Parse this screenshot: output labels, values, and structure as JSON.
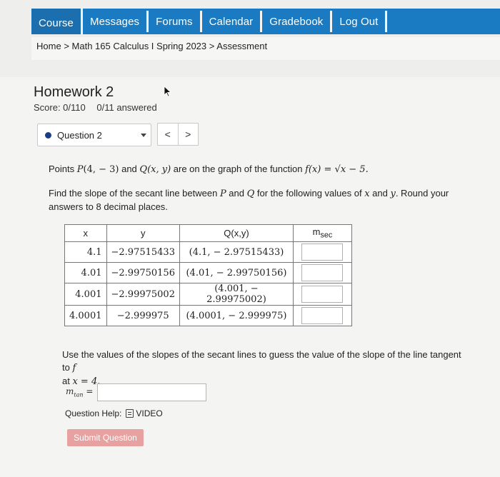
{
  "nav": {
    "tabs": [
      "Course",
      "Messages",
      "Forums",
      "Calendar",
      "Gradebook",
      "Log Out"
    ]
  },
  "breadcrumb": {
    "home": "Home",
    "course": "Math 165 Calculus I Spring 2023",
    "current": "Assessment",
    "sep": ">"
  },
  "assignment": {
    "title": "Homework 2",
    "score": "Score: 0/110",
    "answered": "0/11 answered"
  },
  "question_nav": {
    "selected": "Question 2",
    "prev": "<",
    "next": ">"
  },
  "problem": {
    "intro_a": "Points ",
    "P": "P",
    "P_coords": "(4, − 3)",
    "and": " and ",
    "Q": "Q",
    "Q_coords": "(x, y)",
    "intro_b": " are on the graph of the function ",
    "func": "f(x) = √x − 5.",
    "instr_a": "Find the slope of the secant line between ",
    "instr_P": "P",
    "instr_and": " and ",
    "instr_Q": "Q",
    "instr_b": " for the following values of ",
    "instr_x": "x",
    "instr_c": " and ",
    "instr_y": "y",
    "instr_d": ". Round your answers to 8 decimal places."
  },
  "table": {
    "headers": [
      "x",
      "y",
      "Q(x,y)",
      "m"
    ],
    "header_sub": "sec",
    "rows": [
      {
        "x": "4.1",
        "y": "−2.97515433",
        "q": "(4.1, − 2.97515433)",
        "m": ""
      },
      {
        "x": "4.01",
        "y": "−2.99750156",
        "q": "(4.01, − 2.99750156)",
        "m": ""
      },
      {
        "x": "4.001",
        "y": "−2.99975002",
        "q": "(4.001, − 2.99975002)",
        "m": ""
      },
      {
        "x": "4.0001",
        "y": "−2.999975",
        "q": "(4.0001, − 2.999975)",
        "m": ""
      }
    ]
  },
  "tangent": {
    "text_a": "Use the values of the slopes of the secant lines to guess the value of the slope of the line tangent to ",
    "f": "f",
    "text_b": "at ",
    "at": "x = 4.",
    "mtan_label": "m",
    "mtan_sub": "tan",
    "mtan_eq": " =",
    "mtan_value": ""
  },
  "help": {
    "label": "Question Help:",
    "video": "VIDEO"
  },
  "submit": {
    "label": "Submit Question"
  },
  "colors": {
    "nav_blue": "#1a7ac2",
    "submit_pink": "#e7a1a1",
    "dot_blue": "#1c3e8a"
  },
  "icons": [
    "mouse-pointer-icon",
    "chevron-down-icon",
    "document-icon"
  ]
}
